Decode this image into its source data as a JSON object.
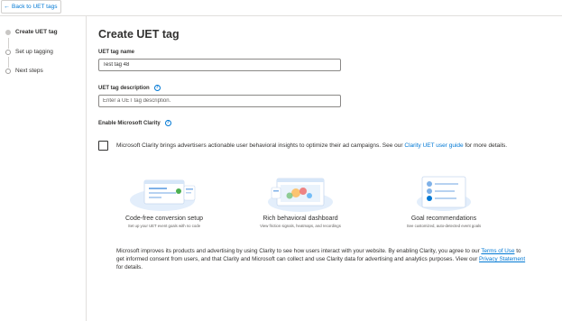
{
  "header": {
    "back_label": "Back to UET tags"
  },
  "steps": [
    {
      "label": "Create UET tag",
      "active": true
    },
    {
      "label": "Set up tagging",
      "active": false
    },
    {
      "label": "Next steps",
      "active": false
    }
  ],
  "form": {
    "title": "Create UET tag",
    "name_label": "UET tag name",
    "name_value": "Test tag 48",
    "description_label": "UET tag description",
    "description_placeholder": "Enter a UET tag description.",
    "clarity_label": "Enable Microsoft Clarity"
  },
  "clarity": {
    "checked": false,
    "text_before": "Microsoft Clarity brings advertisers actionable user behavioral insights to optimize their ad campaigns. See our ",
    "guide_link": "Clarity UET user guide",
    "text_after": " for more details."
  },
  "features": [
    {
      "title": "Code-free conversion setup",
      "subtitle": "Set up your UET event goals with no code"
    },
    {
      "title": "Rich behavioral dashboard",
      "subtitle": "View friction signals, heatmaps, and recordings"
    },
    {
      "title": "Goal recommendations",
      "subtitle": "See customized, auto-detected event goals"
    }
  ],
  "disclaimer": {
    "part1": "Microsoft improves its products and advertising by using Clarity to see how users interact with your website. By enabling Clarity, you agree to our ",
    "terms_link": "Terms of Use",
    "part2": " to get informed consent from users, and that Clarity and Microsoft can collect and use Clarity data for advertising and analytics purposes. View our ",
    "privacy_link": "Privacy Statement",
    "part3": " for details."
  },
  "colors": {
    "accent": "#0078d4",
    "text": "#323130",
    "border": "#8a8886"
  }
}
